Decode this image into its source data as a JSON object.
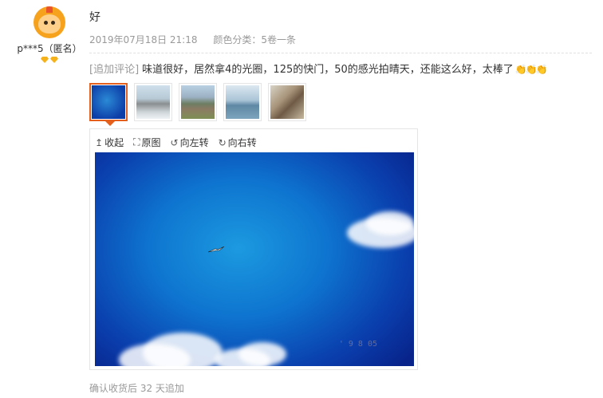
{
  "user": {
    "name": "p***5（匿名）",
    "level_badges": 2
  },
  "review": {
    "text": "好",
    "date": "2019年07月18日 21:18",
    "sku": "颜色分类：5卷一条"
  },
  "append": {
    "tag": "[追加评论]",
    "text": "味道很好，居然拿4的光圈，125的快门，50的感光拍晴天，还能这么好，太棒了",
    "claps": "👏👏👏"
  },
  "thumbnails": [
    {
      "name": "sky-photo",
      "active": true
    },
    {
      "name": "rocks-photo",
      "active": false
    },
    {
      "name": "cliff-photo",
      "active": false
    },
    {
      "name": "sea-photo",
      "active": false
    },
    {
      "name": "portrait-photo",
      "active": false
    }
  ],
  "viewer": {
    "tools": {
      "collapse": "收起",
      "original": "原图",
      "rotate_left": "向左转",
      "rotate_right": "向右转"
    },
    "photo_stamp": "' 9  8  05"
  },
  "footer": {
    "note": "确认收货后 32 天追加"
  },
  "colors": {
    "accent": "#e4601c",
    "muted": "#999999",
    "text": "#333333"
  }
}
